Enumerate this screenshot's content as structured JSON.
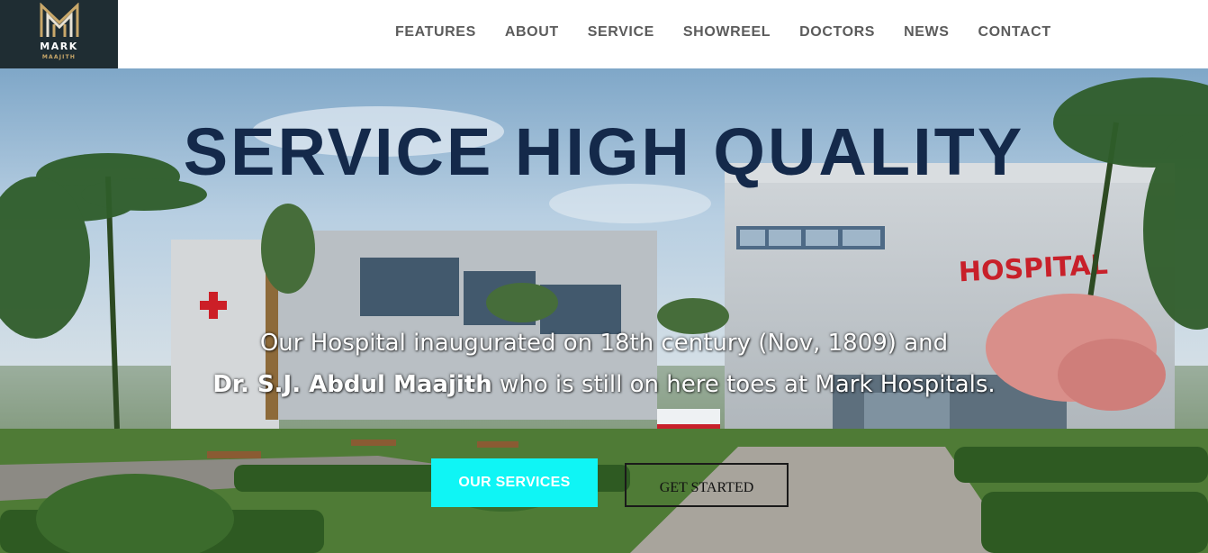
{
  "brand": {
    "name": "MARK",
    "sub": "MAAJITH",
    "colors": {
      "logo_bg": "#1f2d33",
      "logo_accent": "#c9a86a"
    }
  },
  "nav": {
    "items": [
      {
        "label": "FEATURES"
      },
      {
        "label": "ABOUT"
      },
      {
        "label": "SERVICE"
      },
      {
        "label": "SHOWREEL"
      },
      {
        "label": "DOCTORS"
      },
      {
        "label": "NEWS"
      },
      {
        "label": "CONTACT"
      }
    ]
  },
  "hero": {
    "title": "SERVICE HIGH QUALITY",
    "line1": "Our Hospital inaugurated on 18th century (Nov, 1809) and",
    "line2_name": "Dr. S.J. Abdul Maajith",
    "line2_rest": " who is still on here toes at Mark Hospitals.",
    "background_sign": "HOSPITAL",
    "primary_button": "OUR SERVICES",
    "secondary_button": "GET STARTED",
    "colors": {
      "title": "#14294a",
      "primary_button_bg": "#0ff5f5",
      "sign_red": "#c8202a"
    }
  }
}
